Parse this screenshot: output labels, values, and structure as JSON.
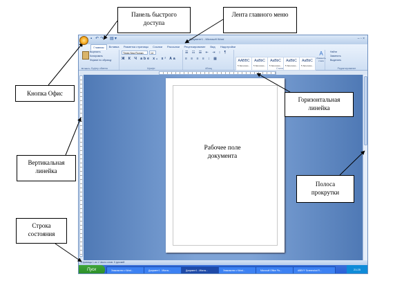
{
  "callouts": {
    "quick_access": "Панель быстрого доступа",
    "ribbon": "Лента главного меню",
    "office_button": "Кнопка Офис",
    "horizontal_ruler": "Горизонтальная линейка",
    "vertical_ruler": "Вертикальная линейка",
    "workspace": "Рабочее поле документа",
    "scrollbar": "Полоса прокрутки",
    "statusbar": "Строка состояния"
  },
  "window": {
    "title": "Документ1 - Microsoft Word",
    "tabs": [
      "Главная",
      "Вставка",
      "Разметка страницы",
      "Ссылки",
      "Рассылки",
      "Рецензирование",
      "Вид",
      "Надстройки"
    ],
    "font_name": "Times New Roman",
    "font_size": "14",
    "groups": [
      "Буфер обмена",
      "Шрифт",
      "Абзац",
      "Стили",
      "Редактирование"
    ],
    "clipboard_items": [
      "Вырезать",
      "Копировать",
      "Формат по образцу"
    ],
    "paste_label": "Вставить",
    "styles": [
      {
        "sample": "AABBC",
        "name": "¶ Заголово..."
      },
      {
        "sample": "AaBbC",
        "name": "¶ Заголово..."
      },
      {
        "sample": "AaBbC",
        "name": "¶ Заголово..."
      },
      {
        "sample": "AaBbC",
        "name": "¶ Заголово..."
      },
      {
        "sample": "AaBbC",
        "name": "¶ Заголово..."
      }
    ],
    "change_styles": "Изменить стили",
    "editing_items": [
      "Найти",
      "Заменить",
      "Выделить"
    ],
    "status_text": "Страница 1 из 1   Число слов: 0   русский"
  },
  "taskbar": {
    "start": "Пуск",
    "tasks": [
      "Знакомство с Word...",
      "Документ1 - Micros...",
      "Документ1 - Micros...",
      "Знакомство с Word...",
      "Microsoft Office Pic...",
      "ABBYY Screenshot R..."
    ],
    "clock": "21:25"
  }
}
